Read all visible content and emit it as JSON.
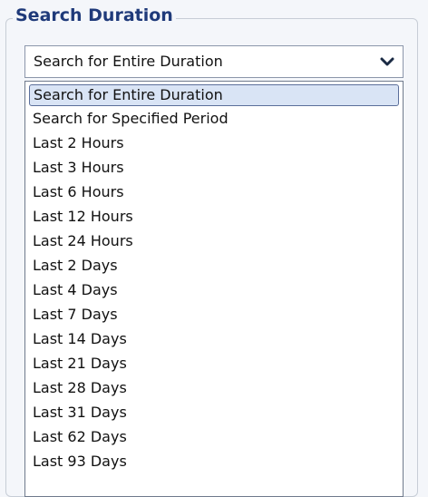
{
  "legend": "Search Duration",
  "select": {
    "value": "Search for Entire Duration",
    "icon": "chevron-down-icon"
  },
  "options": [
    "Search for Entire Duration",
    "Search for Specified Period",
    "Last 2 Hours",
    "Last 3 Hours",
    "Last 6 Hours",
    "Last 12 Hours",
    "Last 24 Hours",
    "Last 2 Days",
    "Last 4 Days",
    "Last 7 Days",
    "Last 14 Days",
    "Last 21 Days",
    "Last 28 Days",
    "Last 31 Days",
    "Last 62 Days",
    "Last 93 Days"
  ],
  "selected_index": 0,
  "colors": {
    "legend_text": "#1f3a7a",
    "selected_bg": "#d9e4f5",
    "selected_border": "#5b6f9a"
  }
}
